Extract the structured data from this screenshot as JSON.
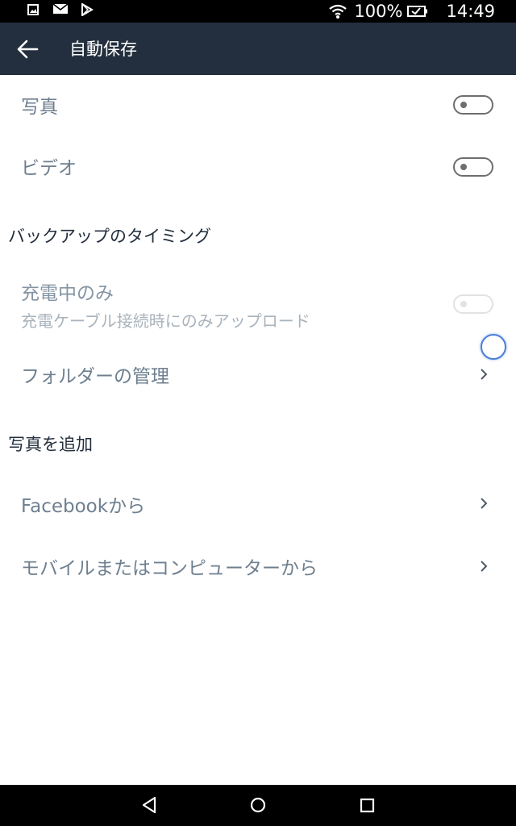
{
  "status_bar": {
    "battery_percent": "100%",
    "time": "14:49",
    "icons": [
      "image-notification-icon",
      "mail-notification-icon",
      "play-store-icon",
      "wifi-icon",
      "battery-icon"
    ]
  },
  "app_bar": {
    "title": "自動保存",
    "back_icon": "arrow-left-icon"
  },
  "upload_types": [
    {
      "label": "写真",
      "enabled": false
    },
    {
      "label": "ビデオ",
      "enabled": false
    }
  ],
  "timing_section": {
    "header": "バックアップのタイミング",
    "charging_only": {
      "label": "充電中のみ",
      "description": "充電ケーブル接続時にのみアップロード",
      "enabled": false,
      "disabled": true
    },
    "folder_management": {
      "label": "フォルダーの管理"
    }
  },
  "add_photos_section": {
    "header": "写真を追加",
    "items": [
      {
        "label": "Facebookから"
      },
      {
        "label": "モバイルまたはコンピューターから"
      }
    ]
  },
  "nav_bar": {
    "buttons": [
      "back-triangle-icon",
      "home-circle-icon",
      "recents-square-icon"
    ]
  },
  "colors": {
    "app_bar": "#232f3e",
    "row_text": "#6e7f8f",
    "section_header_text": "#232f3e",
    "toggle_off": "#6e6e6e",
    "toggle_disabled": "#e2e2e2",
    "spinner": "#4a7fd6"
  }
}
